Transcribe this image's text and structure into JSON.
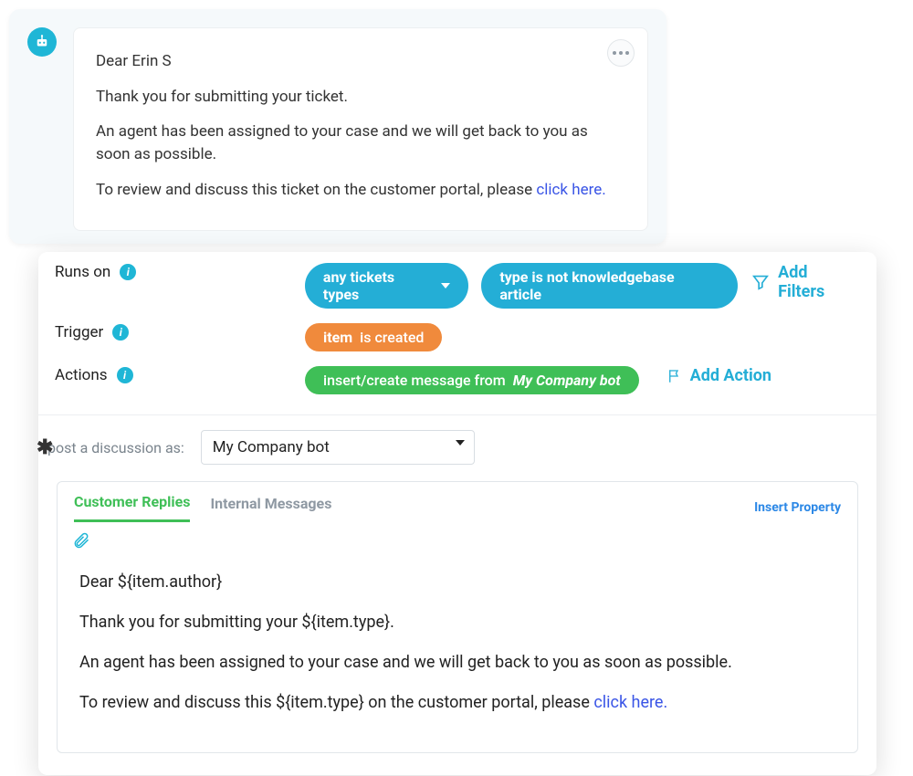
{
  "message": {
    "greeting": "Dear Erin S",
    "p1": "Thank you for submitting your ticket.",
    "p2": "An agent has been assigned to your case and we will get back to you as soon as possible.",
    "p3_pre": "To review and discuss this ticket on the customer portal, please ",
    "link_text": "click here."
  },
  "config": {
    "runs_on_label": "Runs on",
    "trigger_label": "Trigger",
    "actions_label": "Actions",
    "pill_any_types": "any tickets types",
    "pill_not_kb": "type is not knowledgebase article",
    "add_filters": "Add Filters",
    "trigger_item": "item",
    "trigger_is_created": "is created",
    "action_text": "insert/create message from",
    "action_bot": "My Company bot",
    "add_action": "Add Action"
  },
  "post_as": {
    "label": "post a discussion as:",
    "value": "My Company bot"
  },
  "editor": {
    "tab_customer": "Customer Replies",
    "tab_internal": "Internal Messages",
    "insert_property": "Insert Property",
    "body": {
      "p1": "Dear ${item.author}",
      "p2": "Thank you for submitting your ${item.type}.",
      "p3": "An agent has been assigned to your case and we will get back to you as soon as possible.",
      "p4_pre": "To review and discuss this ${item.type} on the customer portal, please ",
      "link": "click here."
    }
  }
}
